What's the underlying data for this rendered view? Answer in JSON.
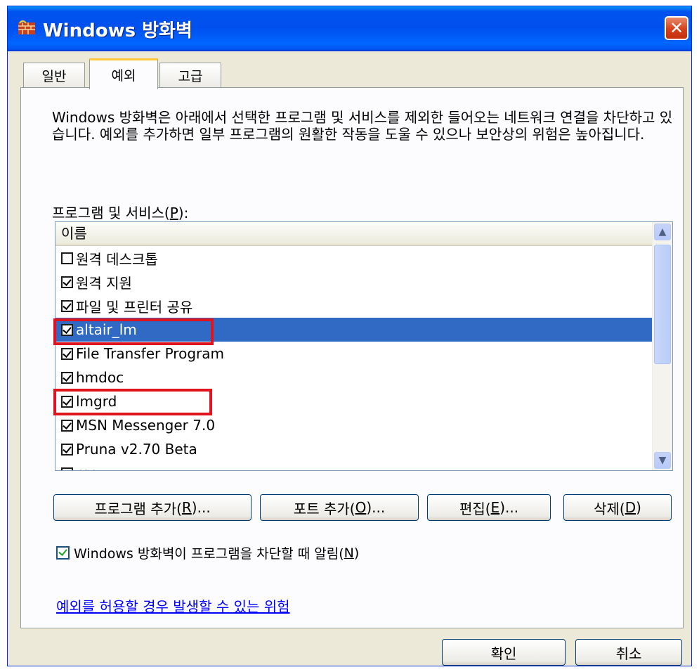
{
  "window": {
    "title": "Windows 방화벽",
    "close_icon": "close-icon"
  },
  "tabs": [
    {
      "label": "일반",
      "active": false
    },
    {
      "label": "예외",
      "active": true
    },
    {
      "label": "고급",
      "active": false
    }
  ],
  "description": "Windows 방화벽은 아래에서 선택한 프로그램 및 서비스를 제외한 들어오는 네트워크 연결을 차단하고 있습니다. 예외를 추가하면 일부 프로그램의 원활한 작동을 도울 수 있으나 보안상의 위험은 높아집니다.",
  "list": {
    "label": "프로그램 및 서비스(",
    "label_key": "P",
    "label_end": "):",
    "column_header": "이름",
    "items": [
      {
        "name": "원격 데스크톱",
        "checked": false,
        "selected": false
      },
      {
        "name": "원격 지원",
        "checked": true,
        "selected": false
      },
      {
        "name": "파일 및 프린터 공유",
        "checked": true,
        "selected": false
      },
      {
        "name": "altair_lm",
        "checked": true,
        "selected": true
      },
      {
        "name": "File Transfer Program",
        "checked": true,
        "selected": false
      },
      {
        "name": "hmdoc",
        "checked": true,
        "selected": false
      },
      {
        "name": "lmgrd",
        "checked": true,
        "selected": false
      },
      {
        "name": "MSN Messenger 7.0",
        "checked": true,
        "selected": false
      },
      {
        "name": "Pruna v2.70 Beta",
        "checked": true,
        "selected": false
      },
      {
        "name": "rcp",
        "checked": true,
        "selected": false
      }
    ]
  },
  "buttons": {
    "add_program": {
      "pre": "프로그램 추가(",
      "key": "R",
      "post": ")..."
    },
    "add_port": {
      "pre": "포트 추가(",
      "key": "O",
      "post": ")..."
    },
    "edit": {
      "pre": "편집(",
      "key": "E",
      "post": ")..."
    },
    "delete": {
      "pre": "삭제(",
      "key": "D",
      "post": ")"
    }
  },
  "notify": {
    "pre": "Windows 방화벽이 프로그램을 차단할 때 알림(",
    "key": "N",
    "post": ")",
    "checked": true
  },
  "risk_link": "예외를 허용할 경우 발생할 수 있는 위험",
  "footer": {
    "ok": "확인",
    "cancel": "취소"
  },
  "colors": {
    "titlebar": "#0054e3",
    "selection": "#316ac5",
    "highlight_box": "#e0141e"
  }
}
